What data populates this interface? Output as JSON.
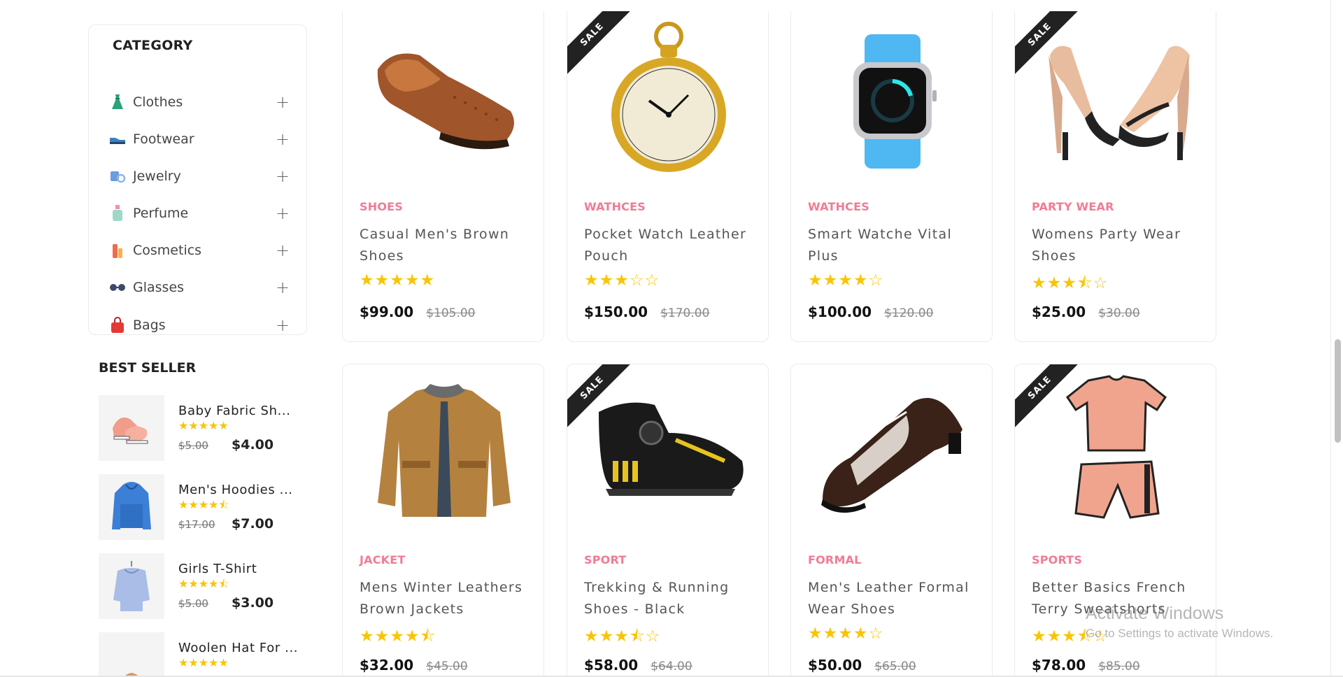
{
  "sidebar": {
    "category_title": "CATEGORY",
    "categories": [
      {
        "label": "Clothes",
        "icon": "dress-icon"
      },
      {
        "label": "Footwear",
        "icon": "shoe-icon"
      },
      {
        "label": "Jewelry",
        "icon": "jewelry-icon"
      },
      {
        "label": "Perfume",
        "icon": "perfume-icon"
      },
      {
        "label": "Cosmetics",
        "icon": "cosmetics-icon"
      },
      {
        "label": "Glasses",
        "icon": "glasses-icon"
      },
      {
        "label": "Bags",
        "icon": "bag-icon"
      }
    ],
    "expand_symbol": "+",
    "best_seller_title": "BEST SELLER",
    "best_sellers": [
      {
        "name": "Baby Fabric Sh...",
        "old_price": "$5.00",
        "new_price": "$4.00",
        "rating": 5
      },
      {
        "name": "Men's Hoodies ...",
        "old_price": "$17.00",
        "new_price": "$7.00",
        "rating": 4.5
      },
      {
        "name": "Girls T-Shirt",
        "old_price": "$5.00",
        "new_price": "$3.00",
        "rating": 4.5
      },
      {
        "name": "Woolen Hat For ...",
        "old_price": "",
        "new_price": "",
        "rating": 5
      }
    ]
  },
  "sale_label": "SALE",
  "products": [
    {
      "category": "SHOES",
      "title": "Casual Men's Brown Shoes",
      "rating": 5,
      "price": "$99.00",
      "old_price": "$105.00",
      "sale": false
    },
    {
      "category": "WATHCES",
      "title": "Pocket Watch Leather Pouch",
      "rating": 3,
      "price": "$150.00",
      "old_price": "$170.00",
      "sale": true
    },
    {
      "category": "WATHCES",
      "title": "Smart Watche Vital Plus",
      "rating": 4,
      "price": "$100.00",
      "old_price": "$120.00",
      "sale": false
    },
    {
      "category": "PARTY WEAR",
      "title": "Womens Party Wear Shoes",
      "rating": 3.5,
      "price": "$25.00",
      "old_price": "$30.00",
      "sale": true
    },
    {
      "category": "JACKET",
      "title": "Mens Winter Leathers Brown Jackets",
      "rating": 4.5,
      "price": "$32.00",
      "old_price": "$45.00",
      "sale": false
    },
    {
      "category": "SPORT",
      "title": "Trekking & Running Shoes - Black",
      "rating": 3.5,
      "price": "$58.00",
      "old_price": "$64.00",
      "sale": true
    },
    {
      "category": "FORMAL",
      "title": "Men's Leather Formal Wear Shoes",
      "rating": 4,
      "price": "$50.00",
      "old_price": "$65.00",
      "sale": false
    },
    {
      "category": "SPORTS",
      "title": "Better Basics French Terry Sweatshorts",
      "rating": 3.5,
      "price": "$78.00",
      "old_price": "$85.00",
      "sale": true
    }
  ],
  "watermark": {
    "title": "Activate Windows",
    "subtitle": "Go to Settings to activate Windows."
  },
  "colors": {
    "category_pink": "#f17b95",
    "star_yellow": "#f8c505",
    "ribbon_black": "#222222"
  }
}
